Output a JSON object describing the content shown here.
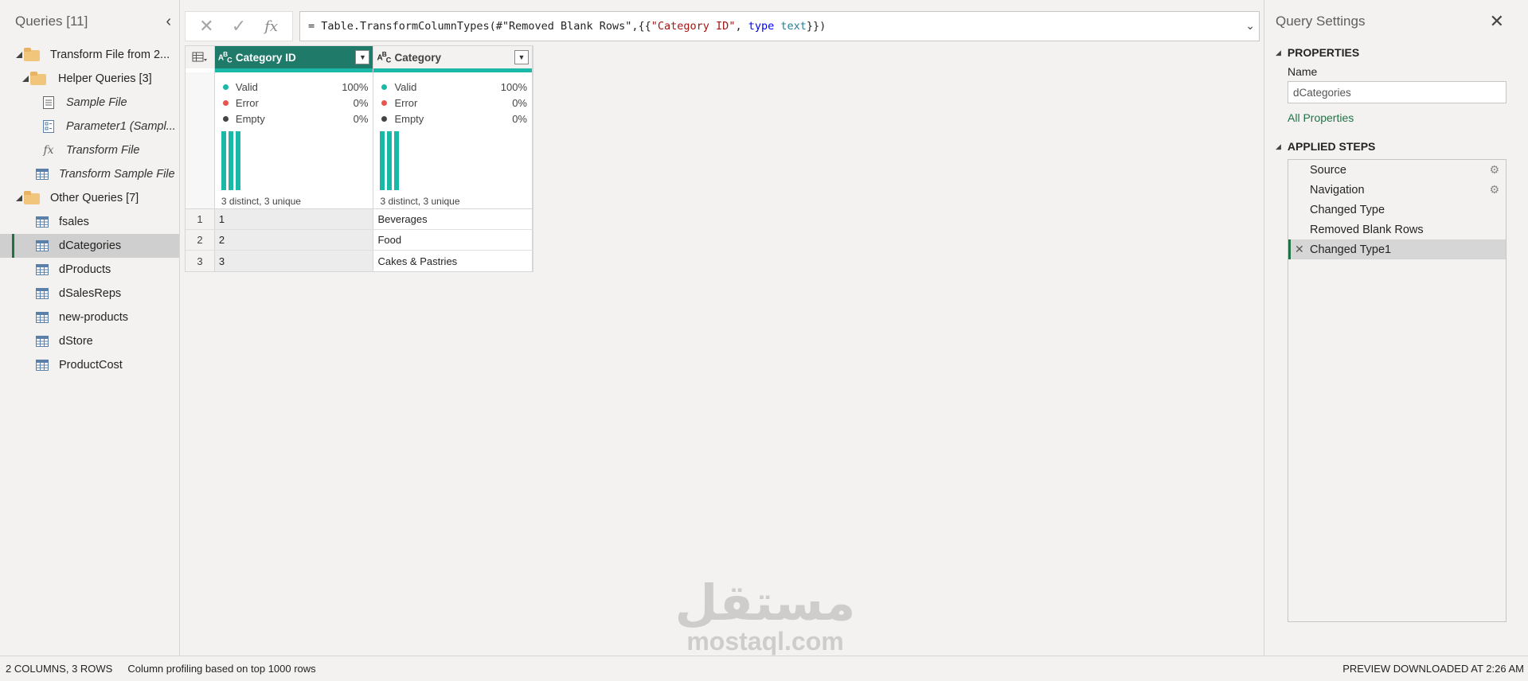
{
  "queries_panel": {
    "title": "Queries [11]",
    "items": [
      {
        "label": "Transform File from 2...",
        "kind": "folder",
        "level": 0,
        "expanded": true
      },
      {
        "label": "Helper Queries [3]",
        "kind": "folder",
        "level": 1,
        "expanded": true
      },
      {
        "label": "Sample File",
        "kind": "file",
        "level": 2,
        "italic": true
      },
      {
        "label": "Parameter1 (Sampl...",
        "kind": "parameter",
        "level": 2,
        "italic": true
      },
      {
        "label": "Transform File",
        "kind": "function",
        "level": 2,
        "italic": true
      },
      {
        "label": "Transform Sample File",
        "kind": "table",
        "level": 1,
        "italic": true
      },
      {
        "label": "Other Queries [7]",
        "kind": "folder",
        "level": 0,
        "expanded": true
      },
      {
        "label": "fsales",
        "kind": "table",
        "level": 1
      },
      {
        "label": "dCategories",
        "kind": "table",
        "level": 1,
        "selected": true
      },
      {
        "label": "dProducts",
        "kind": "table",
        "level": 1
      },
      {
        "label": "dSalesReps",
        "kind": "table",
        "level": 1
      },
      {
        "label": "new-products",
        "kind": "table",
        "level": 1
      },
      {
        "label": "dStore",
        "kind": "table",
        "level": 1
      },
      {
        "label": "ProductCost",
        "kind": "table",
        "level": 1
      }
    ]
  },
  "formula_bar": {
    "cancel_icon": "✕",
    "confirm_icon": "✓",
    "fx_label": "fx",
    "tokens": [
      {
        "t": "= Table.TransformColumnTypes(#\"Removed Blank Rows\",{{",
        "c": "plain"
      },
      {
        "t": "\"Category ID\"",
        "c": "str"
      },
      {
        "t": ", ",
        "c": "plain"
      },
      {
        "t": "type",
        "c": "kw"
      },
      {
        "t": " ",
        "c": "plain"
      },
      {
        "t": "text",
        "c": "type"
      },
      {
        "t": "}})",
        "c": "plain"
      }
    ]
  },
  "grid": {
    "columns": [
      {
        "type_icon": "ABC",
        "name": "Category ID",
        "selected": true,
        "profile": {
          "valid_label": "Valid",
          "valid": "100%",
          "error_label": "Error",
          "error": "0%",
          "empty_label": "Empty",
          "empty": "0%",
          "distinct": "3 distinct, 3 unique",
          "bars": [
            1,
            1,
            1
          ]
        }
      },
      {
        "type_icon": "ABC",
        "name": "Category",
        "selected": false,
        "profile": {
          "valid_label": "Valid",
          "valid": "100%",
          "error_label": "Error",
          "error": "0%",
          "empty_label": "Empty",
          "empty": "0%",
          "distinct": "3 distinct, 3 unique",
          "bars": [
            1,
            1,
            1
          ]
        }
      }
    ],
    "rows": [
      {
        "num": "1",
        "cells": [
          "1",
          "Beverages"
        ]
      },
      {
        "num": "2",
        "cells": [
          "2",
          "Food"
        ]
      },
      {
        "num": "3",
        "cells": [
          "3",
          "Cakes & Pastries"
        ]
      }
    ],
    "colors": {
      "valid": "#1ab8a6",
      "error": "#e8554e",
      "empty": "#444444"
    }
  },
  "query_settings": {
    "title": "Query Settings",
    "properties_heading": "PROPERTIES",
    "name_label": "Name",
    "name_value": "dCategories",
    "all_properties_link": "All Properties",
    "applied_steps_heading": "APPLIED STEPS",
    "steps": [
      {
        "label": "Source",
        "gear": true
      },
      {
        "label": "Navigation",
        "gear": true
      },
      {
        "label": "Changed Type",
        "gear": false
      },
      {
        "label": "Removed Blank Rows",
        "gear": false
      },
      {
        "label": "Changed Type1",
        "gear": false,
        "selected": true
      }
    ]
  },
  "status_bar": {
    "dims": "2 COLUMNS, 3 ROWS",
    "profiling": "Column profiling based on top 1000 rows",
    "preview": "PREVIEW DOWNLOADED AT 2:26 AM"
  },
  "watermark": {
    "arabic": "مستقل",
    "latin": "mostaql.com"
  },
  "accent_color": "#217346",
  "header_color": "#1f7a69"
}
